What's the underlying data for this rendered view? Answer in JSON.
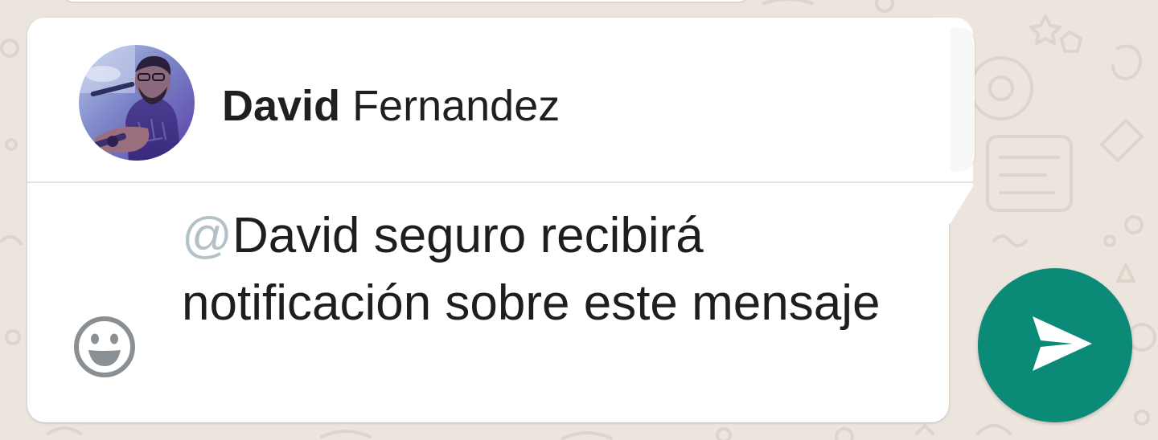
{
  "mention_suggestion": {
    "contact_first_name": "David",
    "contact_last_name": " Fernandez",
    "avatar": "contact-photo-avatar"
  },
  "composer": {
    "mention_symbol": "@",
    "message_text": "David seguro recibirá notificación sobre este mensaje",
    "emoji_icon": "smiley-icon",
    "send_icon": "send-arrow-icon"
  },
  "colors": {
    "send_button": "#0b8a78",
    "mention_symbol": "#b3c2c9",
    "chat_wallpaper": "#ece5dd"
  }
}
